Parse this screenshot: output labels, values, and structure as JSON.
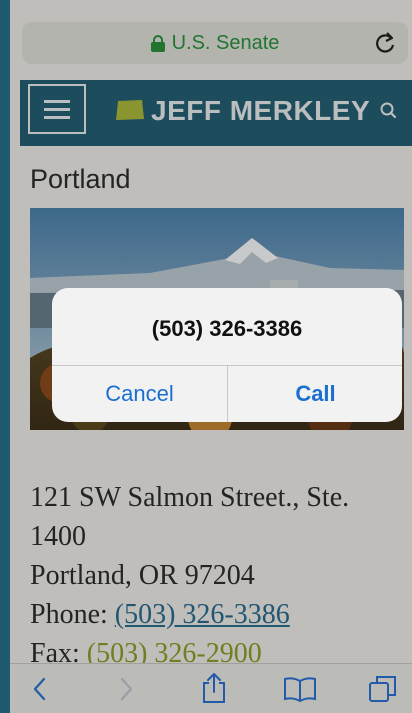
{
  "browser": {
    "url_label": "U.S. Senate",
    "secure": true,
    "reload_icon": "reload-icon"
  },
  "site": {
    "brand_name": "JEFF MERKLEY",
    "menu_icon": "hamburger-menu-icon",
    "search_icon": "search-icon",
    "header_color": "#245f72"
  },
  "page": {
    "title": "Portland",
    "photo": "mount-hood-portland-photo",
    "address_line1": "121 SW Salmon Street., Ste.",
    "address_line2": "1400",
    "address_line3": "Portland, OR 97204",
    "phone_label": "Phone:",
    "phone_number": "(503) 326-3386",
    "fax_label": "Fax:",
    "fax_number": "(503) 326-2900"
  },
  "dialog": {
    "number": "(503) 326-3386",
    "cancel_label": "Cancel",
    "call_label": "Call",
    "button_color": "#1a6fd0"
  },
  "toolbar": {
    "icons": [
      "back-icon",
      "forward-icon",
      "share-icon",
      "bookmarks-icon",
      "tabs-icon"
    ]
  }
}
